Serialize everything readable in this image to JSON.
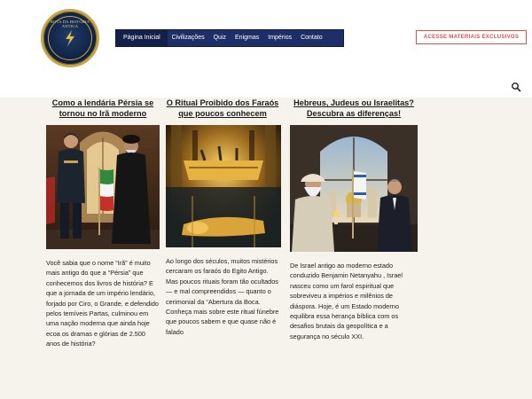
{
  "logo": {
    "text": "ROTA DA HISTÓRIA ANTIGA"
  },
  "nav": {
    "items": [
      "Página Inicial",
      "Civilizações",
      "Quiz",
      "Enigmas",
      "Impérios",
      "Contato"
    ]
  },
  "cta": {
    "label": "ACESSE MATERIAIS EXCLUSIVOS"
  },
  "colors": {
    "nav_bg": "#1d2f66",
    "cta": "#d9534f",
    "page_bg": "#f6f3ec",
    "logo_gold": "#c9a54a"
  },
  "articles": [
    {
      "title": "Como a lendária Pérsia se tornou no Irã moderno",
      "text": "Você sabia que o nome “Irã” é muito mais antigo do que a “Pérsia” que conhecemos dos livros de história? E que a jornada de um império lendário, forjado por Ciro, o Grande, e defendido pelos temíveis Partas, culminou em uma nação moderna que ainda hoje ecoa os dramas e glórias de 2.500 anos de história?"
    },
    {
      "title": "O Ritual Proibido dos Faraós que poucos conhecem",
      "text": "Ao longo dos séculos, muitos mistérios cercaram os faraós do Egito Antigo. Mas poucos rituais foram tão ocultados — e mal compreendidos — quanto o cerimonial da “Abertura da Boca. Conheça mais sobre este ritual fúnebre que poucos sabem e que quase não é falado"
    },
    {
      "title": "Hebreus, Judeus ou Israelitas? Descubra as diferenças!",
      "text": "De Israel antigo ao moderno estado conduzido  Benjamin Netanyahu , Israel nasceu como um farol espiritual que sobreviveu a impérios e milênios de diáspora. Hoje, é um  Estado moderno equilibra essa herança bíblica com os desafios brutais da geopolítica e a segurança no século XXI."
    }
  ]
}
